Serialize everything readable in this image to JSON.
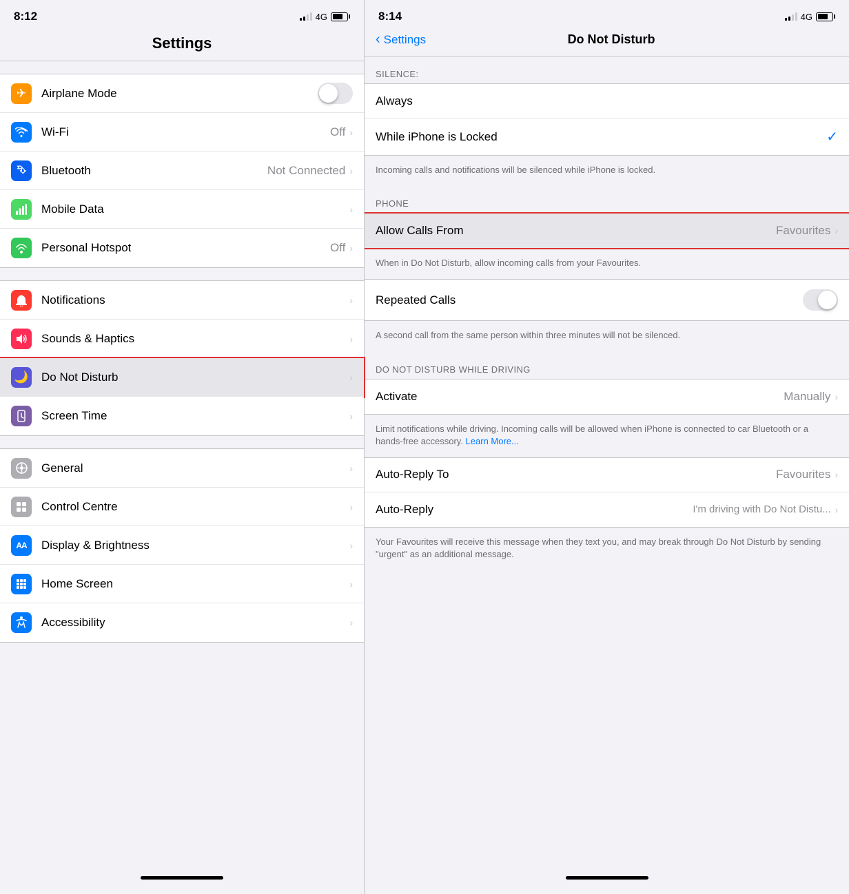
{
  "left": {
    "status": {
      "time": "8:12",
      "network": "4G"
    },
    "header": {
      "title": "Settings"
    },
    "sections": [
      {
        "id": "connectivity",
        "items": [
          {
            "id": "airplane-mode",
            "label": "Airplane Mode",
            "icon_color": "orange",
            "icon": "✈",
            "has_toggle": true,
            "toggle_on": false
          },
          {
            "id": "wifi",
            "label": "Wi-Fi",
            "icon_color": "blue",
            "icon": "wifi",
            "value": "Off",
            "has_chevron": true
          },
          {
            "id": "bluetooth",
            "label": "Bluetooth",
            "icon_color": "blue-dark",
            "icon": "bt",
            "value": "Not Connected",
            "has_chevron": true
          },
          {
            "id": "mobile-data",
            "label": "Mobile Data",
            "icon_color": "green",
            "icon": "signal",
            "value": "",
            "has_chevron": true
          },
          {
            "id": "personal-hotspot",
            "label": "Personal Hotspot",
            "icon_color": "green2",
            "icon": "hotspot",
            "value": "Off",
            "has_chevron": true
          }
        ]
      },
      {
        "id": "notifications",
        "items": [
          {
            "id": "notifications",
            "label": "Notifications",
            "icon_color": "red",
            "icon": "bell",
            "value": "",
            "has_chevron": true
          },
          {
            "id": "sounds-haptics",
            "label": "Sounds & Haptics",
            "icon_color": "pink",
            "icon": "sound",
            "value": "",
            "has_chevron": true
          },
          {
            "id": "do-not-disturb",
            "label": "Do Not Disturb",
            "icon_color": "purple",
            "icon": "moon",
            "value": "",
            "has_chevron": true,
            "highlighted": true
          },
          {
            "id": "screen-time",
            "label": "Screen Time",
            "icon_color": "purple2",
            "icon": "hourglass",
            "value": "",
            "has_chevron": true
          }
        ]
      },
      {
        "id": "general",
        "items": [
          {
            "id": "general",
            "label": "General",
            "icon_color": "light-gray",
            "icon": "gear",
            "value": "",
            "has_chevron": true
          },
          {
            "id": "control-centre",
            "label": "Control Centre",
            "icon_color": "light-gray",
            "icon": "sliders",
            "value": "",
            "has_chevron": true
          },
          {
            "id": "display-brightness",
            "label": "Display & Brightness",
            "icon_color": "blue",
            "icon": "AA",
            "value": "",
            "has_chevron": true
          },
          {
            "id": "home-screen",
            "label": "Home Screen",
            "icon_color": "blue",
            "icon": "grid",
            "value": "",
            "has_chevron": true
          },
          {
            "id": "accessibility",
            "label": "Accessibility",
            "icon_color": "blue",
            "icon": "person",
            "value": "",
            "has_chevron": true
          }
        ]
      }
    ]
  },
  "right": {
    "status": {
      "time": "8:14",
      "network": "4G"
    },
    "nav": {
      "back_label": "Settings",
      "title": "Do Not Disturb"
    },
    "silence_section": {
      "header": "SILENCE:",
      "items": [
        {
          "id": "always",
          "label": "Always",
          "checked": false
        },
        {
          "id": "while-locked",
          "label": "While iPhone is Locked",
          "checked": true
        }
      ],
      "description": "Incoming calls and notifications will be silenced while iPhone is locked."
    },
    "phone_section": {
      "header": "PHONE",
      "items": [
        {
          "id": "allow-calls-from",
          "label": "Allow Calls From",
          "value": "Favourites",
          "has_chevron": true,
          "highlighted": true
        }
      ],
      "description": "When in Do Not Disturb, allow incoming calls from your Favourites."
    },
    "repeated_calls_section": {
      "items": [
        {
          "id": "repeated-calls",
          "label": "Repeated Calls",
          "has_toggle": true,
          "toggle_on": false
        }
      ],
      "description": "A second call from the same person within three minutes will not be silenced."
    },
    "driving_section": {
      "header": "DO NOT DISTURB WHILE DRIVING",
      "items": [
        {
          "id": "activate",
          "label": "Activate",
          "value": "Manually",
          "has_chevron": true
        }
      ],
      "description_parts": [
        {
          "text": "Limit notifications while driving. Incoming calls will be allowed when iPhone is connected to car Bluetooth or a hands-free accessory. "
        },
        {
          "text": "Learn More...",
          "is_link": true
        }
      ]
    },
    "auto_reply_section": {
      "items": [
        {
          "id": "auto-reply-to",
          "label": "Auto-Reply To",
          "value": "Favourites",
          "has_chevron": true
        },
        {
          "id": "auto-reply",
          "label": "Auto-Reply",
          "value": "I'm driving with Do Not Distu...",
          "has_chevron": true
        }
      ],
      "description": "Your Favourites will receive this message when they text you, and may break through Do Not Disturb by sending \"urgent\" as an additional message."
    }
  }
}
